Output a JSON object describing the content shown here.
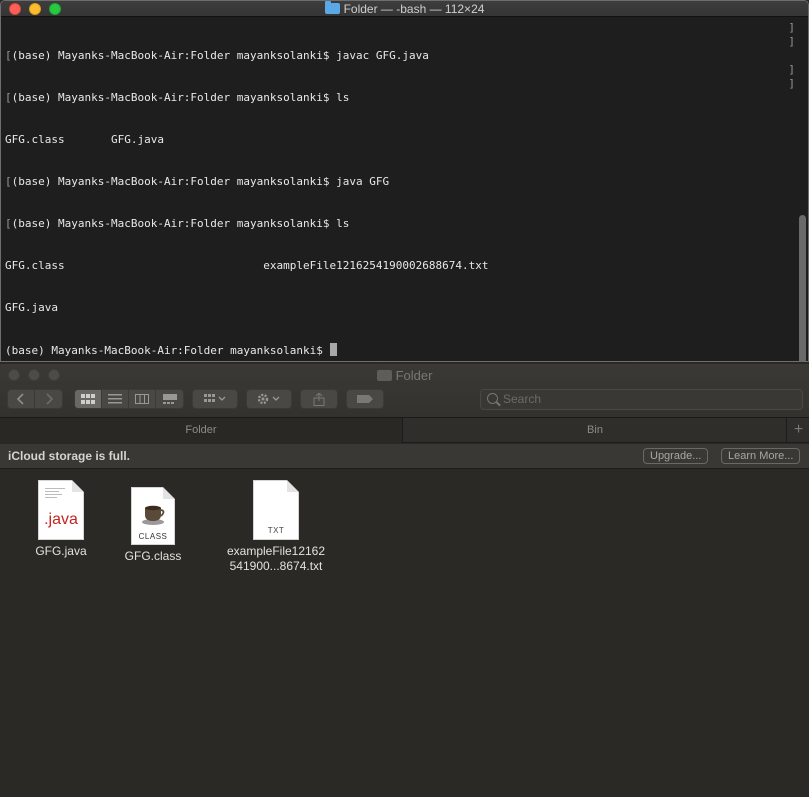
{
  "terminal": {
    "title": "Folder — -bash — 112×24",
    "lines": [
      {
        "prefix": "[",
        "text": "(base) Mayanks-MacBook-Air:Folder mayanksolanki$ javac GFG.java"
      },
      {
        "prefix": "[",
        "text": "(base) Mayanks-MacBook-Air:Folder mayanksolanki$ ls"
      },
      {
        "prefix": "",
        "text": "GFG.class       GFG.java"
      },
      {
        "prefix": "[",
        "text": "(base) Mayanks-MacBook-Air:Folder mayanksolanki$ java GFG"
      },
      {
        "prefix": "[",
        "text": "(base) Mayanks-MacBook-Air:Folder mayanksolanki$ ls"
      },
      {
        "prefix": "",
        "text": "GFG.class                              exampleFile1216254190002688674.txt"
      },
      {
        "prefix": "",
        "text": "GFG.java"
      }
    ],
    "prompt": "(base) Mayanks-MacBook-Air:Folder mayanksolanki$ "
  },
  "finder": {
    "title": "Folder",
    "search_placeholder": "Search",
    "tabs": [
      {
        "label": "Folder"
      },
      {
        "label": "Bin"
      }
    ],
    "add_tab": "+",
    "icloud": {
      "message": "iCloud storage is full.",
      "upgrade": "Upgrade...",
      "learn_more": "Learn More..."
    },
    "files": [
      {
        "name": "GFG.java",
        "badge": ".java"
      },
      {
        "name": "GFG.class",
        "badge": "CLASS"
      },
      {
        "name_line1": "exampleFile12162",
        "name_line2": "541900...8674.txt",
        "badge": "TXT"
      }
    ]
  }
}
